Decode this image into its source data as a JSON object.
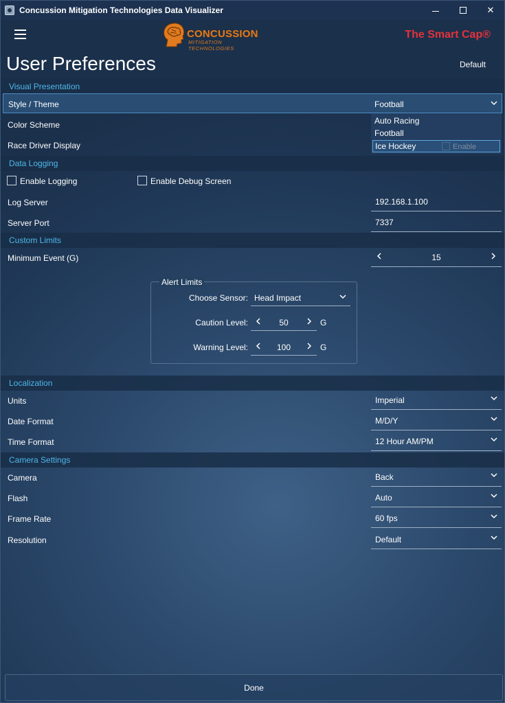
{
  "window": {
    "title": "Concussion Mitigation Technologies Data Visualizer",
    "controls": {
      "minimize": "minimize",
      "maximize": "maximize",
      "close": "✕"
    }
  },
  "header": {
    "logo_title": "CONCUSSION",
    "logo_subtitle": "MITIGATION TECHNOLOGIES",
    "tagline": "The Smart Cap®",
    "page_title": "User Preferences",
    "default_button": "Default"
  },
  "visual": {
    "section": "Visual Presentation",
    "style_label": "Style / Theme",
    "style_value": "Football",
    "color_label": "Color Scheme",
    "race_label": "Race Driver Display",
    "race_ghost": "Enable",
    "dropdown_options": [
      "Auto Racing",
      "Football",
      "Ice Hockey"
    ],
    "dropdown_highlighted": "Ice Hockey"
  },
  "logging": {
    "section": "Data Logging",
    "enable_logging": "Enable Logging",
    "enable_debug": "Enable Debug Screen",
    "log_server_label": "Log Server",
    "log_server_value": "192.168.1.100",
    "server_port_label": "Server Port",
    "server_port_value": "7337"
  },
  "limits": {
    "section": "Custom Limits",
    "min_event_label": "Minimum Event (G)",
    "min_event_value": "15",
    "alert_title": "Alert Limits",
    "sensor_label": "Choose Sensor:",
    "sensor_value": "Head Impact",
    "caution_label": "Caution Level:",
    "caution_value": "50",
    "warning_label": "Warning Level:",
    "warning_value": "100",
    "unit": "G"
  },
  "localization": {
    "section": "Localization",
    "units_label": "Units",
    "units_value": "Imperial",
    "date_label": "Date Format",
    "date_value": "M/D/Y",
    "time_label": "Time Format",
    "time_value": "12 Hour AM/PM"
  },
  "camera": {
    "section": "Camera Settings",
    "camera_label": "Camera",
    "camera_value": "Back",
    "flash_label": "Flash",
    "flash_value": "Auto",
    "framerate_label": "Frame Rate",
    "framerate_value": "60 fps",
    "resolution_label": "Resolution",
    "resolution_value": "Default"
  },
  "footer": {
    "done": "Done"
  },
  "colors": {
    "accent_text": "#4fb8ea",
    "logo_orange": "#e07b1f",
    "tagline_red": "#e4323b",
    "titlebar": "#1d3250"
  }
}
